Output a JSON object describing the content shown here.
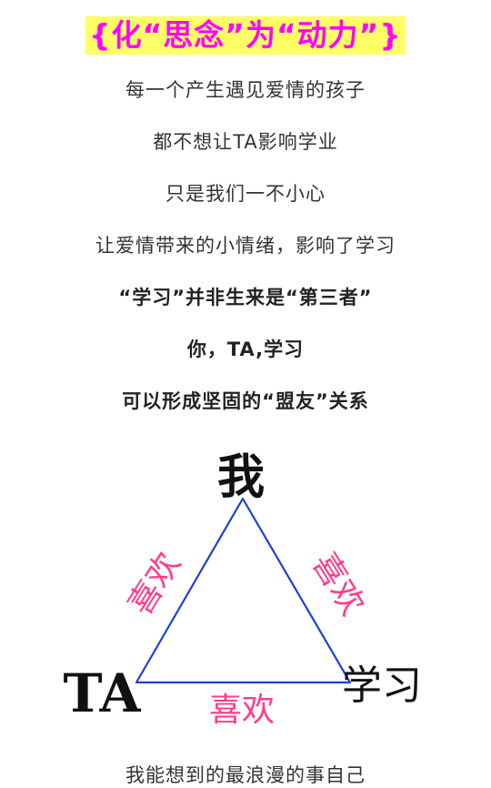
{
  "header": {
    "title": "{化“思念”为“动力”}"
  },
  "paragraphs": [
    "每一个产生遇见爱情的孩子",
    "都不想让TA影响学业",
    "只是我们一不小心",
    "让爱情带来的小情绪，影响了学习",
    "“学习”并非生来是“第三者”",
    "你，TA,学习",
    "可以形成坚固的“盟友”关系"
  ],
  "diagram": {
    "top_label": "我",
    "left_label": "TA",
    "right_label": "学习",
    "edge_left": "喜欢",
    "edge_right": "喜欢",
    "edge_bottom": "喜欢",
    "colors": {
      "triangle": "#1f3fd8",
      "edge_text": "#ff3c8a",
      "node_text": "#111111"
    }
  },
  "footer": {
    "partial_text": "我能想到的最浪漫的事自己"
  },
  "colors": {
    "title_text": "#ff00ff",
    "title_highlight": "#ffff66"
  }
}
